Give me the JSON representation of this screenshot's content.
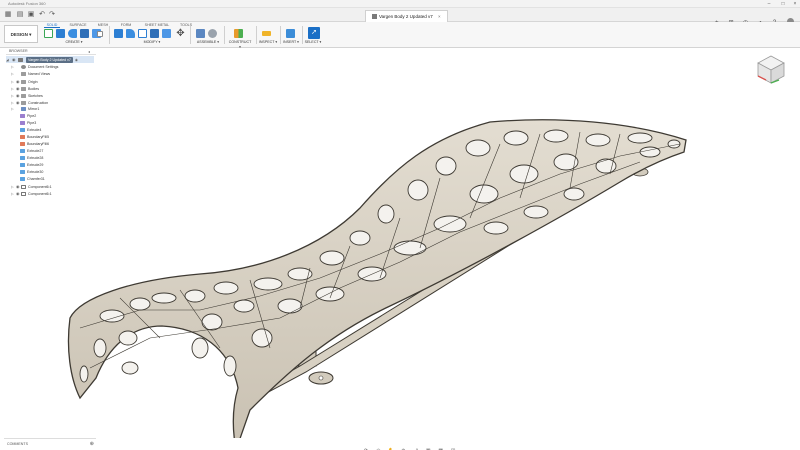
{
  "window": {
    "app_title": "Autodesk Fusion 360"
  },
  "document_tab": {
    "label": "Vargen Body 2 Updated v7"
  },
  "workspace": {
    "label": "DESIGN ▾"
  },
  "ribbon": {
    "tabs": [
      {
        "label": "SOLID",
        "active": true
      },
      {
        "label": "SURFACE"
      },
      {
        "label": "MESH"
      },
      {
        "label": "FORM"
      },
      {
        "label": "SHEET METAL"
      },
      {
        "label": "TOOLS"
      }
    ],
    "groups": [
      {
        "label": "CREATE ▾"
      },
      {
        "label": "MODIFY ▾"
      },
      {
        "label": "ASSEMBLE ▾"
      },
      {
        "label": "CONSTRUCT ▾"
      },
      {
        "label": "INSPECT ▾"
      },
      {
        "label": "INSERT ▾"
      },
      {
        "label": "SELECT ▾"
      }
    ]
  },
  "browser": {
    "title": "BROWSER",
    "root": "Vargen Body 2 Updated v7",
    "items": [
      "Document Settings",
      "Named Views",
      "Origin",
      "Bodies",
      "Sketches",
      "Construction",
      "Mirror1",
      "Pipe2",
      "Pipe3",
      "Extrude4",
      "BoundaryFill5",
      "BoundaryFill6",
      "Extrude27",
      "Extrude28",
      "Extrude29",
      "Extrude30",
      "Chamfer31",
      "Component6:1",
      "Component6:1"
    ]
  },
  "comments": {
    "label": "COMMENTS"
  },
  "colors": {
    "accent": "#1a6fc6",
    "model_fill": "#d9d3c6",
    "model_edge": "#3e3a33",
    "model_shadow": "#a39b8b"
  },
  "icons": {
    "ribbon_create": [
      "new-sketch-icon",
      "extrude-icon",
      "revolve-icon",
      "box-icon",
      "sweep-icon",
      "pattern-icon"
    ],
    "ribbon_modify": [
      "press-pull-icon",
      "fillet-icon",
      "shell-icon",
      "combine-icon",
      "align-icon",
      "move-icon"
    ],
    "ribbon_assemble": [
      "new-component-icon",
      "joint-icon"
    ],
    "ribbon_construct": [
      "plane-icon"
    ],
    "ribbon_inspect": [
      "measure-icon"
    ],
    "ribbon_insert": [
      "insert-image-icon"
    ],
    "ribbon_select": [
      "select-cursor-icon"
    ],
    "navbar": [
      "orbit-icon",
      "look-at-icon",
      "pan-icon",
      "zoom-icon",
      "fit-icon",
      "display-settings-icon",
      "grid-icon",
      "viewports-icon"
    ]
  }
}
